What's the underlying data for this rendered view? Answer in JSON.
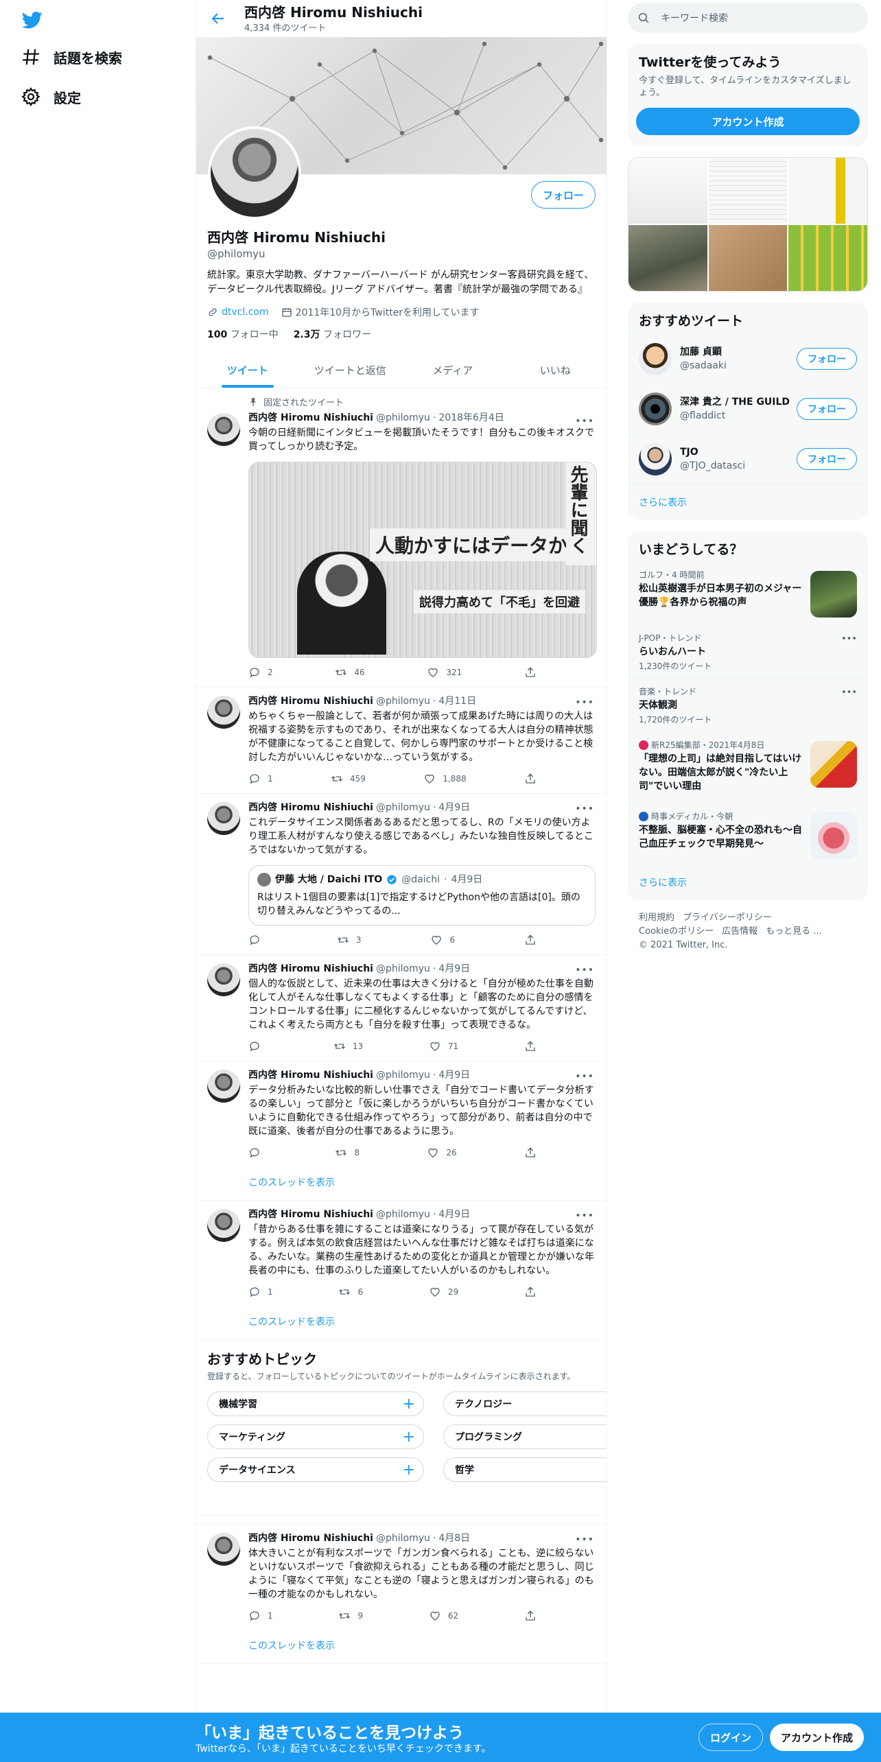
{
  "nav": {
    "explore_label": "話題を検索",
    "settings_label": "設定"
  },
  "profile": {
    "name": "西内啓 Hiromu Nishiuchi",
    "tweet_count": "4,334 件のツイート",
    "handle": "@philomyu",
    "bio": "統計家。東京大学助教、ダナファーバーハーバード がん研究センター客員研究員を経て、データビークル代表取締役。Jリーグ アドバイザー。著書『統計学が最強の学問である』",
    "url": "dtvcl.com",
    "joined": "2011年10月からTwitterを利用しています",
    "following_count": "100",
    "following_label": "フォロー中",
    "followers_count": "2.3万",
    "followers_label": "フォロワー",
    "follow_label": "フォロー"
  },
  "tabs": [
    {
      "label": "ツイート"
    },
    {
      "label": "ツイートと返信"
    },
    {
      "label": "メディア"
    },
    {
      "label": "いいね"
    }
  ],
  "tweets": [
    {
      "context": "固定されたツイート",
      "name": "西内啓 Hiromu Nishiuchi",
      "handle": "@philomyu",
      "date": "2018年6月4日",
      "text": "今朝の日経新聞にインタビューを掲載頂いたそうです！自分もこの後キオスクで買ってしっかり読む予定。",
      "media_headline": "人動かすにはデータから",
      "media_sub": "説得力高めて「不毛」を回避",
      "media_corner": "先輩に聞く",
      "replies": "2",
      "retweets": "46",
      "likes": "321"
    },
    {
      "name": "西内啓 Hiromu Nishiuchi",
      "handle": "@philomyu",
      "date": "4月11日",
      "text": "めちゃくちゃ一般論として、若者が何か頑張って成果あげた時には周りの大人は祝福する姿勢を示すものであり、それが出来なくなってる大人は自分の精神状態が不健康になってること自覚して、何かしら専門家のサポートとか受けること検討した方がいいんじゃないかな…っていう気がする。",
      "replies": "1",
      "retweets": "459",
      "likes": "1,888"
    },
    {
      "name": "西内啓 Hiromu Nishiuchi",
      "handle": "@philomyu",
      "date": "4月9日",
      "text": "これデータサイエンス関係者あるあるだと思ってるし、Rの「メモリの使い方より理工系人材がすんなり使える感じであるべし」みたいな独自性反映してるところではないかって気がする。",
      "quote_name": "伊藤 大地 / Daichi ITO",
      "quote_handle": "@daichi",
      "quote_date": "4月9日",
      "quote_text": "Rはリスト1個目の要素は[1]で指定するけどPythonや他の言語は[0]。頭の切り替えみんなどうやってるの...",
      "replies": "",
      "retweets": "3",
      "likes": "6"
    },
    {
      "name": "西内啓 Hiromu Nishiuchi",
      "handle": "@philomyu",
      "date": "4月9日",
      "text": "個人的な仮説として、近未来の仕事は大きく分けると「自分が極めた仕事を自動化して人がそんな仕事しなくてもよくする仕事」と「顧客のために自分の感情をコントロールする仕事」に二極化するんじゃないかって気がしてるんですけど、これよく考えたら両方とも「自分を殺す仕事」って表現できるな。",
      "replies": "",
      "retweets": "13",
      "likes": "71"
    },
    {
      "name": "西内啓 Hiromu Nishiuchi",
      "handle": "@philomyu",
      "date": "4月9日",
      "text": "データ分析みたいな比較的新しい仕事でさえ「自分でコード書いてデータ分析するの楽しい」って部分と「仮に楽しかろうがいちいち自分がコード書かなくていいように自動化できる仕組み作ってやろう」って部分があり、前者は自分の中で既に道楽、後者が自分の仕事であるように思う。",
      "replies": "",
      "retweets": "8",
      "likes": "26",
      "thread": "このスレッドを表示"
    },
    {
      "name": "西内啓 Hiromu Nishiuchi",
      "handle": "@philomyu",
      "date": "4月9日",
      "text": "「昔からある仕事を雑にすることは道楽になりうる」って罠が存在している気がする。例えば本気の飲食店経営はたいへんな仕事だけど雑なそば打ちは道楽になる、みたいな。業務の生産性あげるための変化とか道具とか管理とかが嫌いな年長者の中にも、仕事のふりした道楽してたい人がいるのかもしれない。",
      "replies": "1",
      "retweets": "6",
      "likes": "29",
      "thread": "このスレッドを表示"
    },
    {
      "name": "西内啓 Hiromu Nishiuchi",
      "handle": "@philomyu",
      "date": "4月8日",
      "text": "体大きいことが有利なスポーツで「ガンガン食べられる」ことも、逆に絞らないといけないスポーツで「食欲抑えられる」こともある種の才能だと思うし、同じように「寝なくて平気」なことも逆の「寝ようと思えばガンガン寝られる」のも一種の才能なのかもしれない。",
      "replies": "1",
      "retweets": "9",
      "likes": "62",
      "thread": "このスレッドを表示"
    }
  ],
  "topics": {
    "title": "おすすめトピック",
    "subtitle": "登録すると、フォローしているトピックについてのツイートがホームタイムラインに表示されます。",
    "items": [
      "機械学習",
      "テクノロジー",
      "マーケティング",
      "プログラミング",
      "データサイエンス",
      "哲学"
    ]
  },
  "search": {
    "placeholder": "キーワード検索"
  },
  "try_twitter": {
    "title": "Twitterを使ってみよう",
    "subtitle": "今すぐ登録して、タイムラインをカスタマイズしましょう。",
    "button": "アカウント作成"
  },
  "who_to_follow": {
    "title": "おすすめツイート",
    "follow_label": "フォロー",
    "users": [
      {
        "name": "加藤 貞顕",
        "handle": "@sadaaki"
      },
      {
        "name": "深津 貴之 / THE GUILD",
        "handle": "@fladdict"
      },
      {
        "name": "TJO",
        "handle": "@TJO_datasci"
      }
    ],
    "show_more": "さらに表示"
  },
  "trends": {
    "title": "いまどうしてる？",
    "items": [
      {
        "context": "ゴルフ・4 時間前",
        "title": "松山英樹選手が日本男子初のメジャー優勝🏆各界から祝福の声",
        "count": ""
      },
      {
        "context": "J-POP・トレンド",
        "title": "らいおんハート",
        "count": "1,230件のツイート"
      },
      {
        "context": "音楽・トレンド",
        "title": "天体観測",
        "count": "1,720件のツイート"
      },
      {
        "context": "新R25編集部・2021年4月8日",
        "title": "「理想の上司」は絶対目指してはいけない。田端信太郎が説く\"冷たい上司\"でいい理由",
        "count": ""
      },
      {
        "context": "時事メディカル・今朝",
        "title": "不整脈、脳梗塞・心不全の恐れも～自己血圧チェックで早期発見～",
        "count": ""
      }
    ],
    "show_more": "さらに表示"
  },
  "footer": {
    "links": [
      "利用規約",
      "プライバシーポリシー",
      "Cookieのポリシー",
      "広告情報",
      "もっと見る ..."
    ],
    "copyright": "© 2021 Twitter, Inc."
  },
  "bottom_bar": {
    "title": "「いま」起きていることを見つけよう",
    "subtitle": "Twitterなら、「いま」起きていることをいち早くチェックできます。",
    "login": "ログイン",
    "signup": "アカウント作成"
  },
  "colors": {
    "accent": "#1d9bf0",
    "text": "#0f1419",
    "muted": "#536471"
  }
}
